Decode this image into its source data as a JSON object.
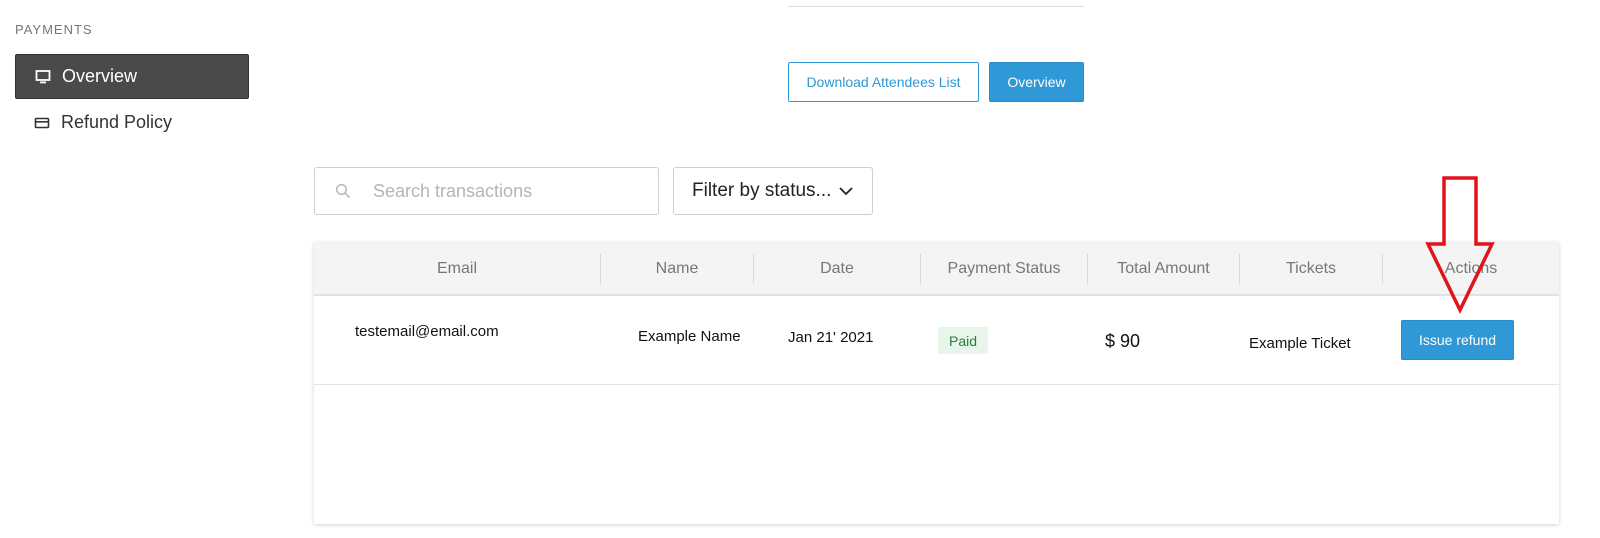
{
  "sidebar": {
    "heading": "PAYMENTS",
    "items": [
      {
        "label": "Overview",
        "icon": "monitor-icon",
        "active": true
      },
      {
        "label": "Refund Policy",
        "icon": "credit-card-icon",
        "active": false
      }
    ]
  },
  "toolbar": {
    "download_label": "Download Attendees List",
    "overview_label": "Overview"
  },
  "search": {
    "placeholder": "Search transactions",
    "icon": "search-icon"
  },
  "filter": {
    "label": "Filter by status...",
    "icon": "chevron-down-icon"
  },
  "table": {
    "columns": [
      "Email",
      "Name",
      "Date",
      "Payment Status",
      "Total Amount",
      "Tickets",
      "Actions"
    ],
    "rows": [
      {
        "email": "testemail@email.com",
        "name": "Example Name",
        "date": "Jan 21' 2021",
        "status": "Paid",
        "amount": "$ 90",
        "tickets": "Example Ticket",
        "action": "Issue refund"
      }
    ]
  },
  "colors": {
    "primary": "#2f98d6",
    "sidebar_active": "#4a4a4a",
    "paid_badge_bg": "#e8f5ea",
    "paid_badge_text": "#2c7d38",
    "annotation_arrow": "#e0141c"
  }
}
